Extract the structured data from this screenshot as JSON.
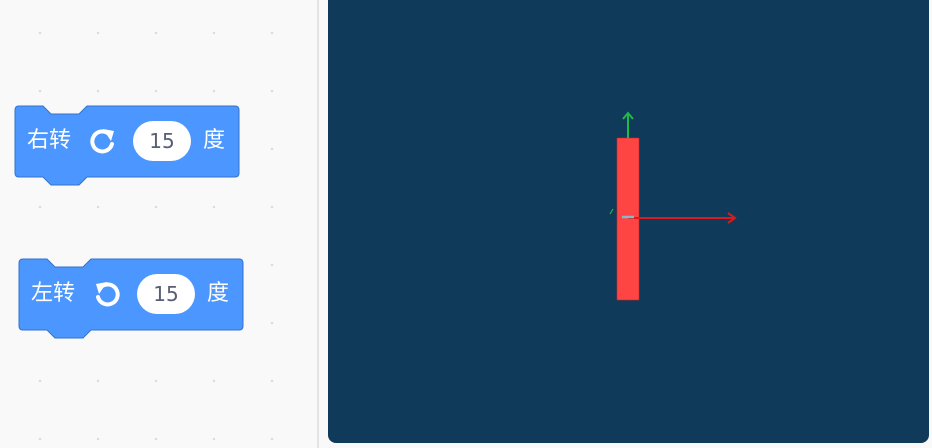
{
  "blocks": [
    {
      "id": "turn-right",
      "label": "右转",
      "icon": "rotate-clockwise-icon",
      "value": "15",
      "unit": "度"
    },
    {
      "id": "turn-left",
      "label": "左转",
      "icon": "rotate-counterclockwise-icon",
      "value": "15",
      "unit": "度"
    }
  ],
  "colors": {
    "block_fill": "#4c97ff",
    "block_border": "#3373cc",
    "stage_bg": "#0f3a59",
    "sprite": "#ff4444",
    "axis_x": "#d81c1c",
    "axis_y": "#22b84a"
  }
}
